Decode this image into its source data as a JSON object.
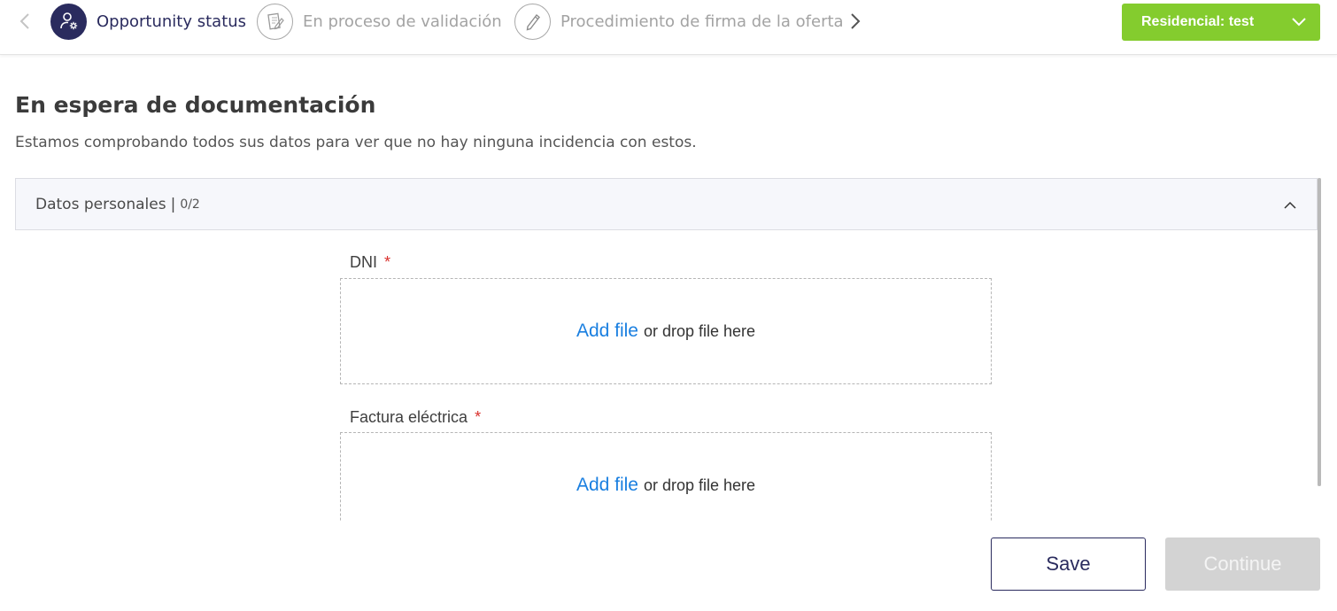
{
  "stepper": {
    "steps": [
      {
        "label": "Opportunity status",
        "state": "active",
        "icon": "user-gear-icon"
      },
      {
        "label": "En proceso de validación",
        "state": "inactive",
        "icon": "document-edit-icon"
      },
      {
        "label": "Procedimiento de firma de la oferta",
        "state": "inactive",
        "icon": "pen-icon"
      }
    ],
    "prev_icon": "chevron-left-icon",
    "next_icon": "chevron-right-icon"
  },
  "selector": {
    "label": "Residencial: test",
    "icon": "chevron-down-icon",
    "color": "#84cc2e"
  },
  "page": {
    "title": "En espera de documentación",
    "subtitle": "Estamos comprobando todos sus datos para ver que no hay ninguna incidencia con estos."
  },
  "section": {
    "title": "Datos personales",
    "separator": "|",
    "count": "0/2",
    "icon": "chevron-up-icon"
  },
  "fields": [
    {
      "label": "DNI",
      "required_mark": "*",
      "add_file": "Add file",
      "drop_text": "or drop file here"
    },
    {
      "label": "Factura eléctrica",
      "required_mark": "*",
      "add_file": "Add file",
      "drop_text": "or drop file here"
    }
  ],
  "footer": {
    "save_label": "Save",
    "continue_label": "Continue"
  },
  "colors": {
    "primary": "#2a2b5e",
    "accent": "#84cc2e",
    "link": "#1a7fe0",
    "required": "#d9302c",
    "disabled": "#d3d3d3"
  }
}
